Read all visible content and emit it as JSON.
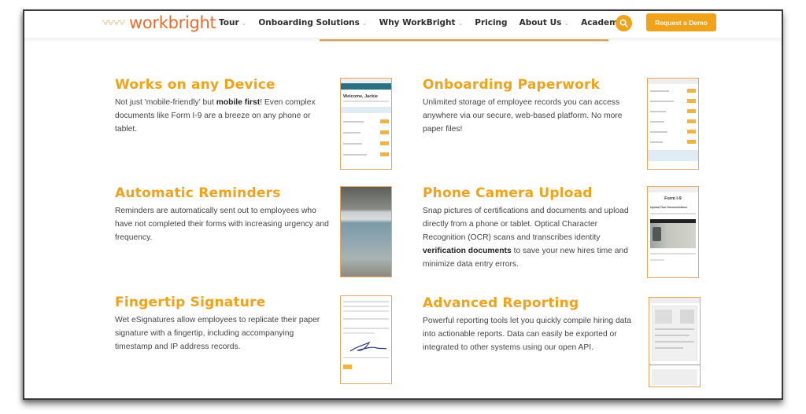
{
  "header": {
    "logo_text": "workbright",
    "nav": [
      {
        "label": "Tour",
        "has_dropdown": true
      },
      {
        "label": "Onboarding Solutions",
        "has_dropdown": true
      },
      {
        "label": "Why WorkBright",
        "has_dropdown": true
      },
      {
        "label": "Pricing",
        "has_dropdown": false
      },
      {
        "label": "About Us",
        "has_dropdown": true
      },
      {
        "label": "Academy",
        "has_dropdown": true
      }
    ],
    "search_icon": "search-icon",
    "cta_label": "Request a Demo"
  },
  "colors": {
    "brand_orange": "#f0a21a",
    "logo_orange": "#ee6a2a",
    "thumb_border": "#e9a55a",
    "body_text": "#444444"
  },
  "features": [
    {
      "title": "Works on any Device",
      "text_before": "Not just 'mobile-friendly' but ",
      "text_bold": "mobile first",
      "text_after": "! Even complex documents like Form I-9 are a breeze on any phone or tablet.",
      "thumb": {
        "type": "phone-screen",
        "heading": "Welcome, Jackie"
      }
    },
    {
      "title": "Onboarding Paperwork",
      "text_before": "Unlimited storage of employee records you can access anywhere via our secure, web-based platform. No more paper files!",
      "text_bold": "",
      "text_after": "",
      "thumb": {
        "type": "document-list"
      }
    },
    {
      "title": "Automatic Reminders",
      "text_before": "Reminders are automatically sent out to employees who have not completed their forms with increasing urgency and frequency.",
      "text_bold": "",
      "text_after": "",
      "thumb": {
        "type": "lock-screen-photo"
      }
    },
    {
      "title": "Phone Camera Upload",
      "text_before": "Snap pictures of certifications and documents and upload directly from a phone or tablet. Optical Character Recognition (OCR) scans and transcribes identity ",
      "text_bold": "verification documents",
      "text_after": " to save your new hires time and minimize data entry errors.",
      "thumb": {
        "type": "id-upload",
        "heading": "Form I-9",
        "subheading": "Upload Your Documentation"
      }
    },
    {
      "title": "Fingertip Signature",
      "text_before": "Wet eSignatures allow employees to replicate their paper signature with a fingertip, including accompanying timestamp and IP address records.",
      "text_bold": "",
      "text_after": "",
      "thumb": {
        "type": "signature"
      }
    },
    {
      "title": "Advanced Reporting",
      "text_before": "Powerful reporting tools let you quickly compile hiring data into actionable reports. Data can easily be exported or integrated to other systems using our open API.",
      "text_bold": "",
      "text_after": "",
      "thumb": {
        "type": "report"
      }
    }
  ]
}
